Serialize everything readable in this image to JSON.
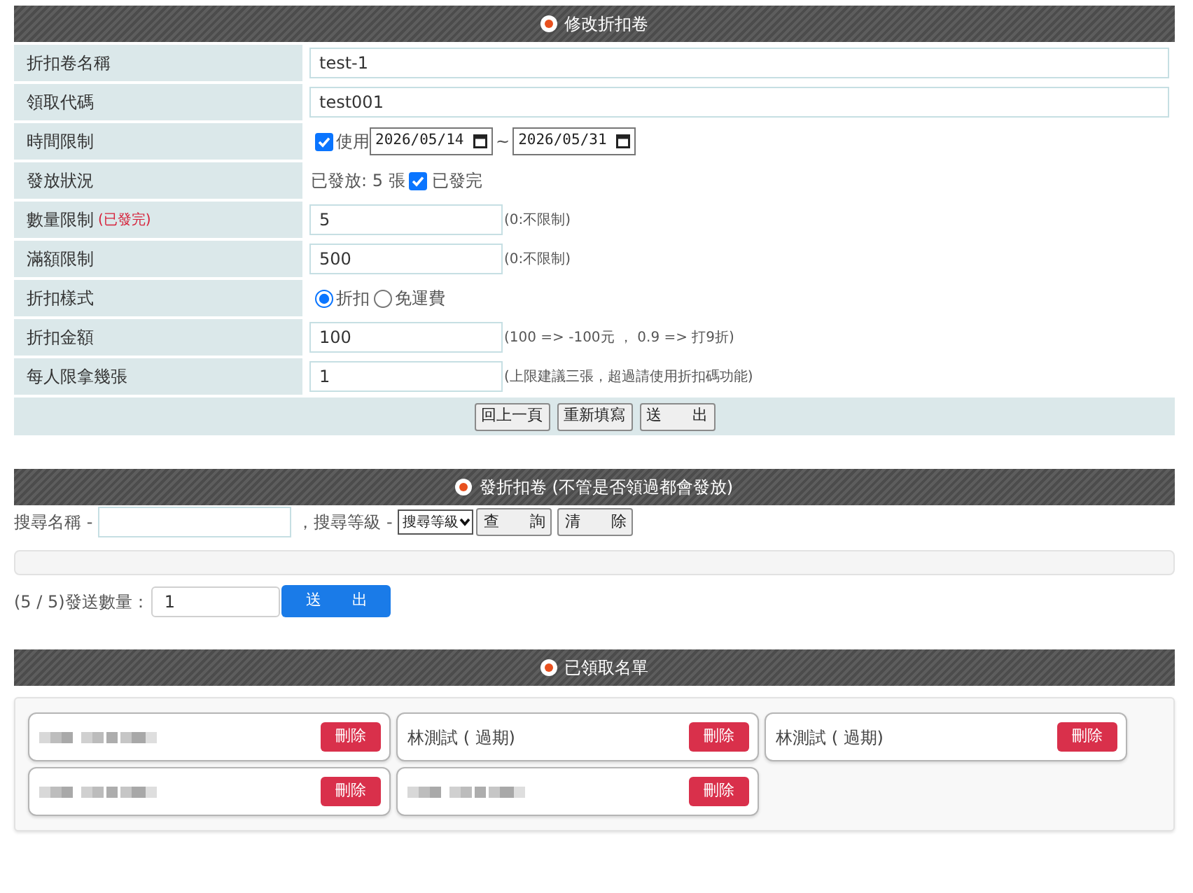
{
  "edit_section": {
    "title": "修改折扣卷",
    "rows": [
      {
        "kind": "text",
        "label": "折扣卷名稱",
        "value": "test-1"
      },
      {
        "kind": "text",
        "label": "領取代碼",
        "value": "test001"
      },
      {
        "kind": "date_range",
        "label": "時間限制",
        "checkbox": {
          "label": "使用",
          "checked": true
        },
        "from": "2026/05/14",
        "separator": "~",
        "to": "2026/05/31"
      },
      {
        "kind": "status",
        "label": "發放狀況",
        "text": "已發放: 5 張",
        "checkbox": {
          "label": "已發完",
          "checked": true
        }
      },
      {
        "kind": "number",
        "label": "數量限制",
        "label_note": "(已發完)",
        "value": "5",
        "hint": "(0:不限制)"
      },
      {
        "kind": "number",
        "label": "滿額限制",
        "value": "500",
        "hint": "(0:不限制)"
      },
      {
        "kind": "radio",
        "label": "折扣樣式",
        "options": [
          {
            "label": "折扣",
            "selected": true
          },
          {
            "label": "免運費",
            "selected": false
          }
        ]
      },
      {
        "kind": "number",
        "label": "折扣金額",
        "value": "100",
        "hint": "(100 => -100元 ， 0.9 => 打9折)"
      },
      {
        "kind": "number",
        "label": "每人限拿幾張",
        "value": "1",
        "hint": "(上限建議三張，超過請使用折扣碼功能)"
      }
    ],
    "buttons": [
      "回上一頁",
      "重新填寫",
      "送　　出"
    ]
  },
  "issue_section": {
    "title": "發折扣卷 (不管是否領過都會發放)",
    "search": {
      "name_label": "搜尋名稱 -",
      "level_label": "，搜尋等級 -",
      "level_select": "搜尋等級",
      "buttons": [
        "查　　詢",
        "清　　除"
      ]
    },
    "send": {
      "label": "(5 / 5)發送數量：",
      "value": "1",
      "button": "送　　出"
    }
  },
  "claimed_section": {
    "title": "已領取名單",
    "items": [
      {
        "kind": "redacted",
        "button": "刪除"
      },
      {
        "kind": "name",
        "name": "林測試 ( 過期)",
        "button": "刪除"
      },
      {
        "kind": "name",
        "name": "林測試 ( 過期)",
        "button": "刪除"
      },
      {
        "kind": "redacted",
        "button": "刪除"
      },
      {
        "kind": "redacted",
        "button": "刪除"
      }
    ]
  }
}
